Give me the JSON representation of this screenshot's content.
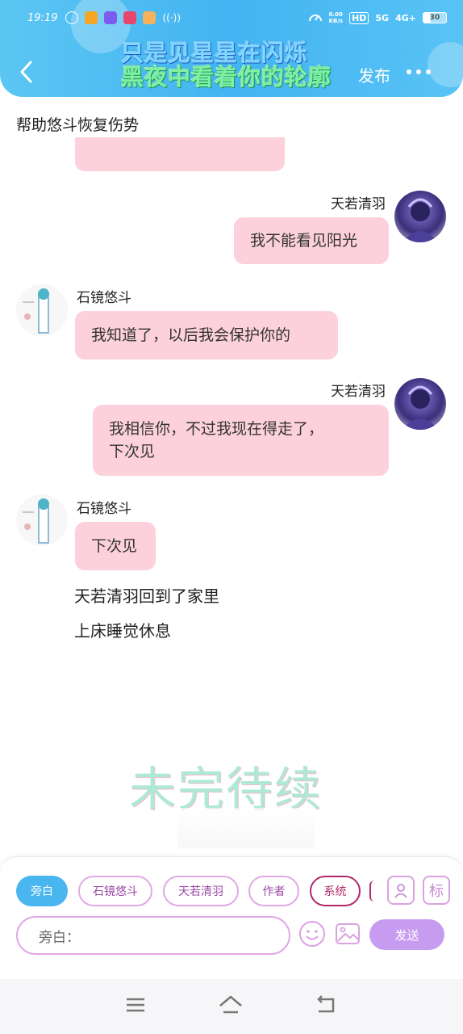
{
  "status_bar": {
    "time": "19:19",
    "net_speed": "0.00\nKB/s",
    "hd": "HD",
    "signal_5g": "5G",
    "signal_4g": "4G+",
    "battery": "30"
  },
  "header": {
    "overlay_line1": "只是见星星在闪烁",
    "overlay_line2": "黑夜中看着你的轮廓",
    "publish_label": "发布"
  },
  "chat": {
    "title": "帮助悠斗恢复伤势",
    "messages": [
      {
        "speaker": "天若清羽",
        "text": "我不能看见阳光"
      },
      {
        "speaker": "石镜悠斗",
        "text": "我知道了，以后我会保护你的"
      },
      {
        "speaker": "天若清羽",
        "text_line1": "我相信你，不过我现在得走了，",
        "text_line2": "下次见"
      },
      {
        "speaker": "石镜悠斗",
        "text": "下次见"
      }
    ],
    "narration": [
      "天若清羽回到了家里",
      "上床睡觉休息"
    ],
    "watermark": "未完待续"
  },
  "input_panel": {
    "chips": [
      "旁白",
      "石镜悠斗",
      "天若清羽",
      "作者",
      "系统"
    ],
    "tag_button": "标",
    "placeholder": "旁白：",
    "send_label": "发送"
  },
  "colors": {
    "header_blue": "#43b4f2",
    "bubble_pink": "#fdd1dc",
    "chip_active": "#49b6ef",
    "send_purple": "#c79cf0"
  }
}
